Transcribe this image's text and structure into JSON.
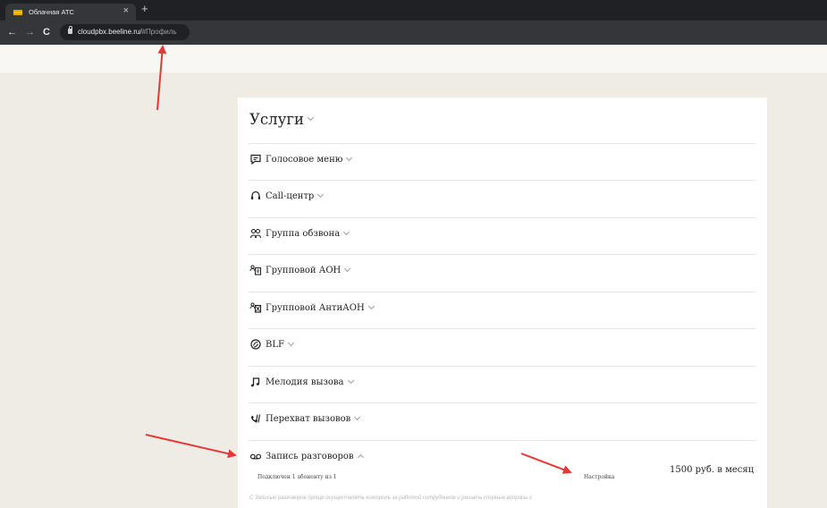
{
  "browser": {
    "tab_title": "Облачная АТС",
    "tab_close": "×",
    "new_tab": "+",
    "url_host": "cloudpbx.beeline.ru/",
    "url_hash": "#Профиль",
    "back": "←",
    "forward": "→",
    "reload": "C"
  },
  "services": {
    "title": "Услуги",
    "items": [
      {
        "label": "Голосовое меню",
        "icon": "chat-bubble-icon"
      },
      {
        "label": "Call-центр",
        "icon": "headset-icon"
      },
      {
        "label": "Группа обзвона",
        "icon": "group-icon"
      },
      {
        "label": "Групповой АОН",
        "icon": "caller-id-icon"
      },
      {
        "label": "Групповой АнтиАОН",
        "icon": "anti-caller-id-icon"
      },
      {
        "label": "BLF",
        "icon": "blf-icon"
      },
      {
        "label": "Мелодия вызова",
        "icon": "music-note-icon"
      },
      {
        "label": "Перехват вызовов",
        "icon": "call-intercept-icon"
      },
      {
        "label": "Запись разговоров",
        "icon": "voicemail-icon"
      }
    ],
    "recording": {
      "connected": "Подключен 1 абоненту из 1",
      "settings": "Настройка",
      "price": "1500 руб. в месяц",
      "description": "С Записью разговоров проще осуществлять контроль за работой сотрудников и решать спорные вопросы с"
    }
  },
  "colors": {
    "annotation_arrow": "#e53935",
    "tab_favicon": "#f5c400"
  }
}
